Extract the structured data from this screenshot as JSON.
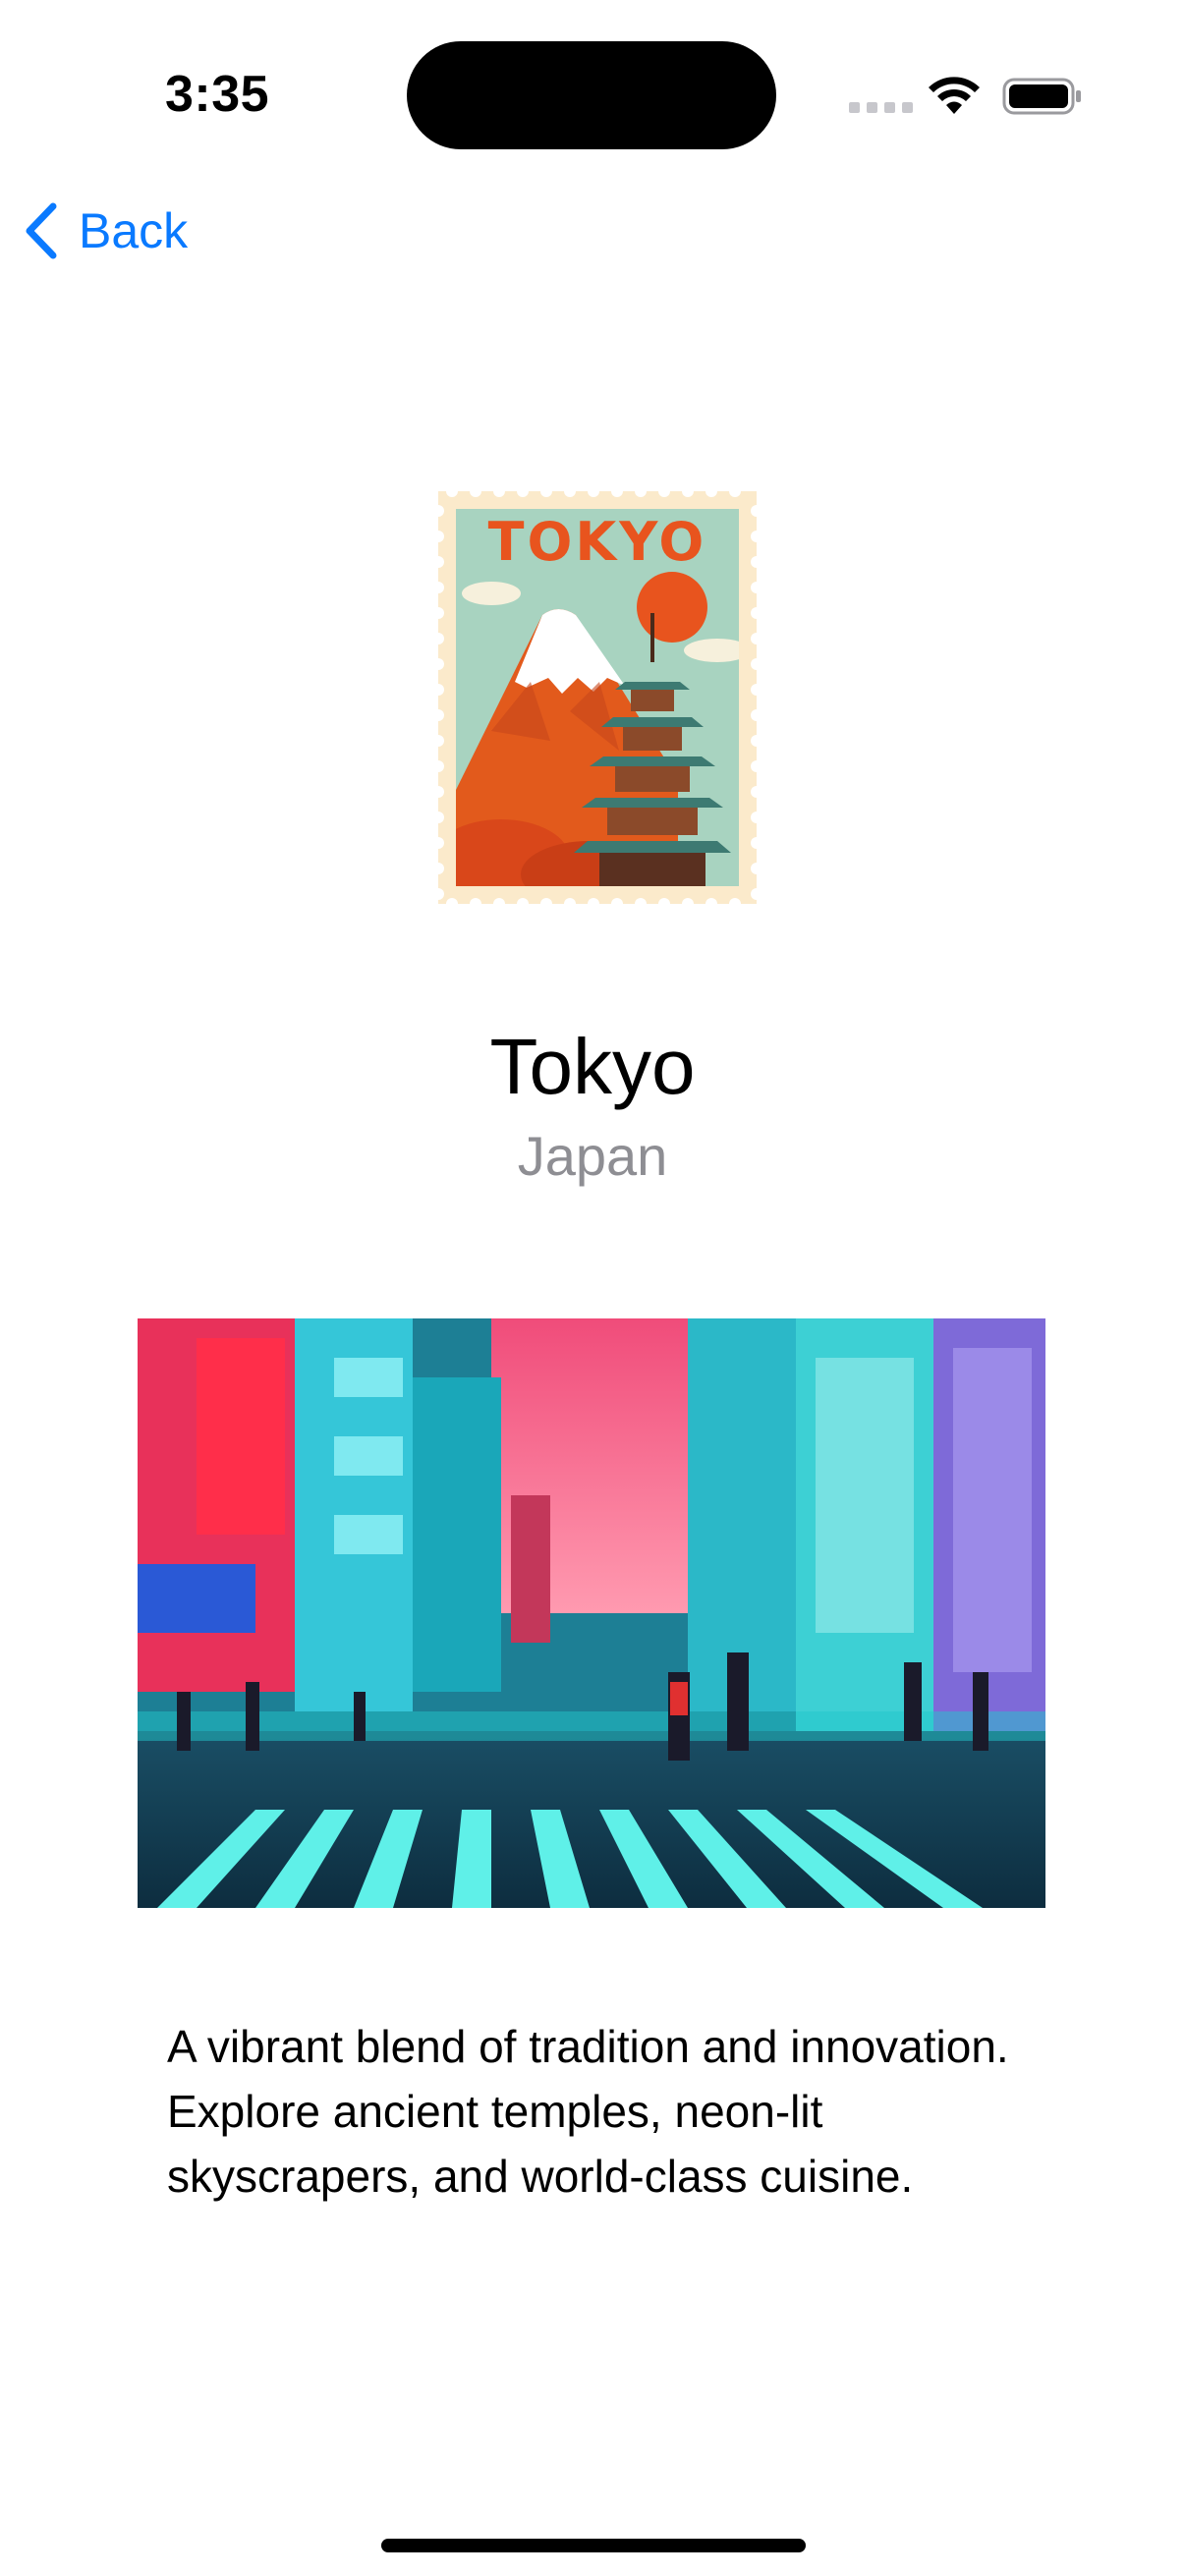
{
  "status_bar": {
    "time": "3:35"
  },
  "nav": {
    "back_label": "Back"
  },
  "stamp": {
    "text": "TOKYO"
  },
  "destination": {
    "city": "Tokyo",
    "country": "Japan",
    "description": "A vibrant blend of tradition and innovation. Explore ancient temples, neon-lit skyscrapers, and world-class cuisine."
  },
  "colors": {
    "accent": "#0a7aff",
    "secondary_text": "#8e8e93"
  }
}
